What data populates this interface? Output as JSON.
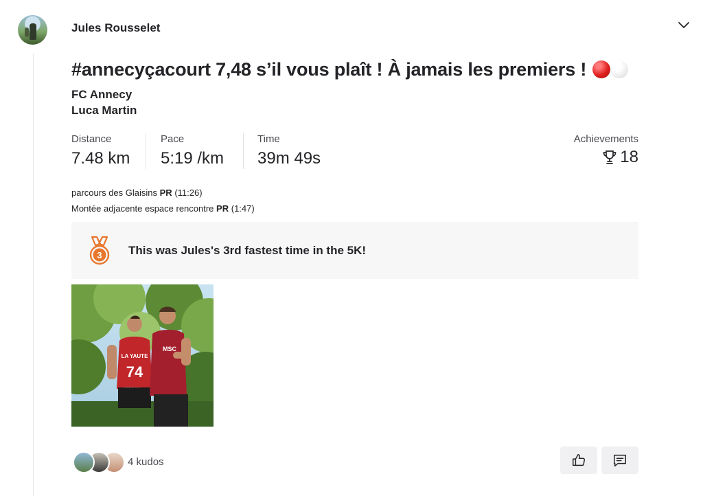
{
  "athlete": {
    "name": "Jules Rousselet"
  },
  "activity": {
    "title": "#annecyçacourt 7,48 s’il vous plaît ! À jamais les premiers !",
    "emoji": [
      "red-circle",
      "white-circle"
    ],
    "tags": [
      "FC Annecy",
      "Luca Martin"
    ]
  },
  "stats": {
    "distance": {
      "label": "Distance",
      "value": "7.48 km"
    },
    "pace": {
      "label": "Pace",
      "value": "5:19 /km"
    },
    "time": {
      "label": "Time",
      "value": "39m 49s"
    },
    "achievements": {
      "label": "Achievements",
      "value": "18",
      "icon": "trophy-icon"
    }
  },
  "segments": [
    {
      "name": "parcours des Glaisins",
      "badge": "PR",
      "time": "(11:26)"
    },
    {
      "name": "Montée adjacente espace rencontre",
      "badge": "PR",
      "time": "(1:47)"
    }
  ],
  "highlight": {
    "text": "This was Jules's 3rd fastest time in the 5K!",
    "medal_number": "3",
    "icon": "bronze-medal-icon",
    "accent": "#e8762b"
  },
  "kudos": {
    "label": "4 kudos"
  },
  "actions": {
    "kudo_icon": "thumbs-up-icon",
    "comment_icon": "comment-icon"
  },
  "colors": {
    "text": "#242428",
    "muted": "#494950",
    "panel": "#f7f7f8",
    "button": "#f0f0f2",
    "accent": "#e8762b"
  }
}
